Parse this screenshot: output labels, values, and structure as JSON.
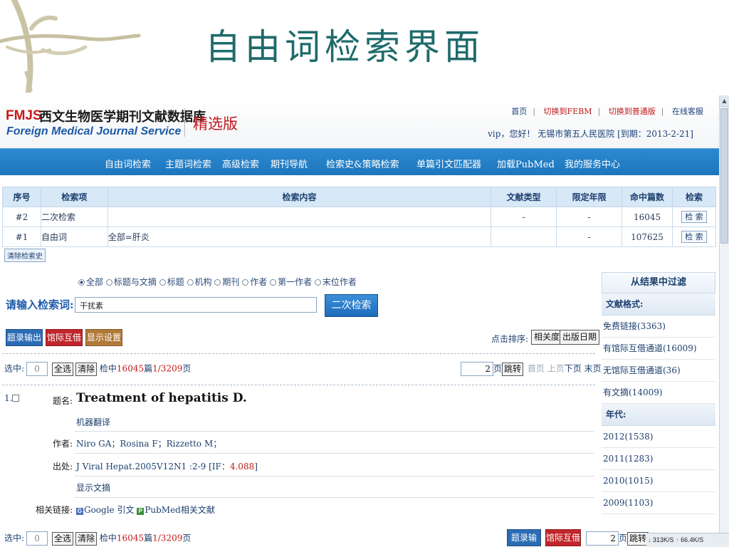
{
  "slide": {
    "title": "自由词检索界面"
  },
  "site": {
    "logo": {
      "brand": "FMJS",
      "name_cn": "西文生物医学期刊文献数据库",
      "name_en": "Foreign Medical Journal Service",
      "edition": "精选版"
    },
    "top_links": [
      "首页",
      "切换到FEBM",
      "切换到普通版",
      "在线客服"
    ],
    "user_info": "vip，您好！ 无锡市第五人民医院 [到期：2013-2-21]",
    "nav": [
      "自由词检索",
      "主题词检索",
      "高级检索",
      "期刊导航",
      "检索史&策略检索",
      "单篇引文匹配器",
      "加载PubMed",
      "我的服务中心"
    ],
    "history_table": {
      "headers": [
        "序号",
        "检索项",
        "检索内容",
        "文献类型",
        "限定年限",
        "命中篇数",
        "检索"
      ],
      "rows": [
        {
          "num": "#2",
          "field": "二次检索",
          "content": "",
          "doc_type": "-",
          "years": "-",
          "hits": "16045",
          "action": "检 索"
        },
        {
          "num": "#1",
          "field": "自由词",
          "content": "全部=肝炎",
          "doc_type": "",
          "years": "-",
          "hits": "107625",
          "action": "检 索"
        }
      ],
      "clear_button": "清除检索史"
    },
    "search": {
      "scopes": [
        "全部",
        "标题与文摘",
        "标题",
        "机构",
        "期刊",
        "作者",
        "第一作者",
        "末位作者"
      ],
      "selected_scope": "全部",
      "label": "请输入检索词:",
      "value": "干扰素",
      "button": "二次检索"
    },
    "action_buttons": {
      "export": "题录输出",
      "ill": "馆际互借",
      "display": "显示设置"
    },
    "sort": {
      "label": "点击排序:",
      "options": [
        "相关度",
        "出版日期"
      ]
    },
    "pager": {
      "select_label": "选中:",
      "selected_count": "0",
      "select_all": "全选",
      "clear": "清除",
      "hit_prefix": "检中",
      "hit_count": "16045",
      "unit_pian": "篇",
      "page_info": "1/3209",
      "unit_page": "页",
      "goto_value": "2",
      "goto_label": "跳转",
      "nav_links": [
        "首页",
        "上页",
        "下页",
        "末页"
      ]
    },
    "record": {
      "index": "1.",
      "labels": {
        "title": "题名:",
        "authors": "作者:",
        "source": "出处:",
        "related": "相关链接:"
      },
      "title": "Treatment of hepatitis D.",
      "machine_translate": "机器翻译",
      "authors": "Niro GA；Rosina F；Rizzetto M；",
      "source_text": "J Viral Hepat.2005V12N1 :2-9  [IF：",
      "impact_factor": "4.088",
      "source_close": "]",
      "show_abstract": "显示文摘",
      "links": [
        "Google 引文",
        "PubMed相关文献"
      ]
    },
    "filter": {
      "header": "从结果中过滤",
      "doc_format_title": "文献格式:",
      "doc_formats": [
        "免费链接(3363)",
        "有馆际互借通道(16009)",
        "无馆际互借通道(36)",
        "有文摘(14009)"
      ],
      "year_title": "年代:",
      "years": [
        "2012(1538)",
        "2011(1283)",
        "2010(1015)",
        "2009(1103)"
      ]
    },
    "bottom_pager": {
      "export": "题录输出",
      "ill": "馆际互借",
      "goto_value": "2",
      "goto_label": "跳转"
    },
    "tray": {
      "down": "313K/S",
      "up": "66.4K/S"
    }
  },
  "colors": {
    "nav": "#1d75bd",
    "title": "#1f6b6b",
    "red_btn": "#c0262b",
    "blue_btn": "#2b6cb5",
    "brown_btn": "#b07a3a"
  }
}
